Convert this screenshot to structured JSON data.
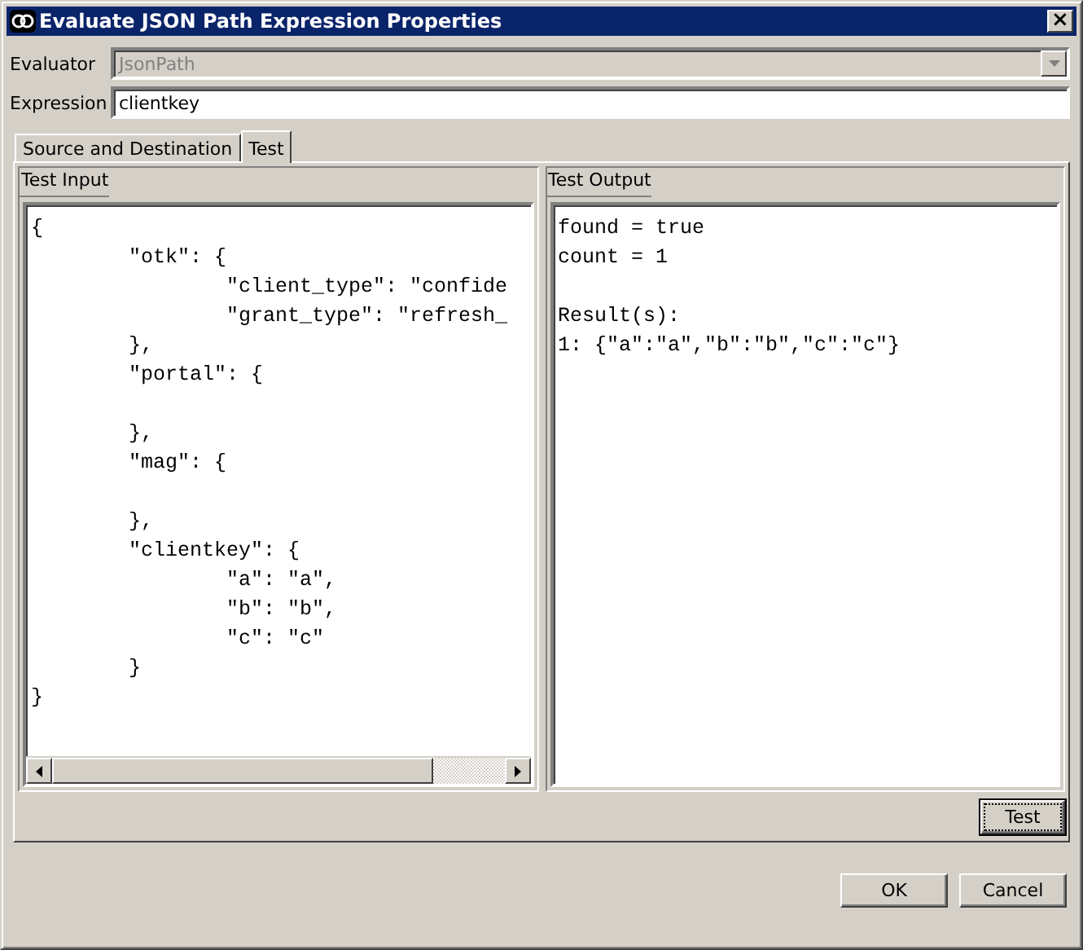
{
  "window": {
    "title": "Evaluate JSON Path Expression Properties",
    "close": "×"
  },
  "evaluator": {
    "label": "Evaluator",
    "value": "JsonPath",
    "disabled": true
  },
  "expression": {
    "label": "Expression",
    "value": "clientkey"
  },
  "tabs": [
    {
      "label": "Source and Destination",
      "selected": false
    },
    {
      "label": "Test",
      "selected": true
    }
  ],
  "test_input": {
    "title": "Test Input",
    "text": "{\n\t\"otk\": {\n\t\t\"client_type\": \"confide\n\t\t\"grant_type\": \"refresh_\n\t},\n\t\"portal\": {\n\n\t},\n\t\"mag\": {\n\n\t},\n\t\"clientkey\": {\n\t\t\"a\": \"a\",\n\t\t\"b\": \"b\",\n\t\t\"c\": \"c\"\n\t}\n}"
  },
  "test_output": {
    "title": "Test Output",
    "text": "found = true\ncount = 1\n\nResult(s):\n1: {\"a\":\"a\",\"b\":\"b\",\"c\":\"c\"}"
  },
  "test_button": "Test",
  "buttons": [
    "OK",
    "Cancel"
  ]
}
